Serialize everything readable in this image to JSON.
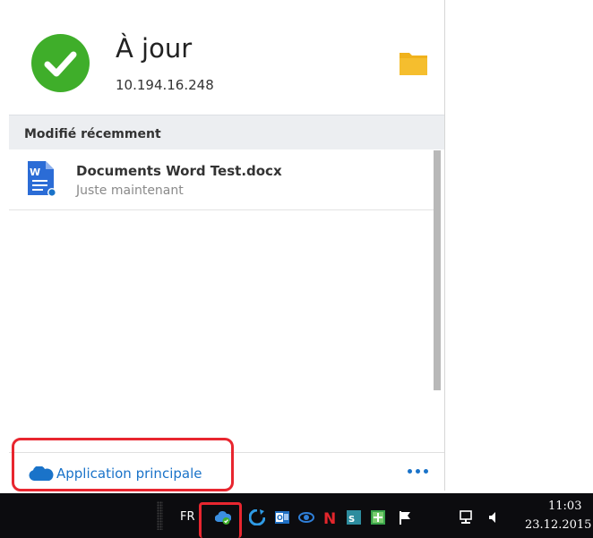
{
  "status": {
    "title": "À jour",
    "ip": "10.194.16.248",
    "icons": {
      "status": "checkmark-icon",
      "folder": "folder-icon"
    },
    "colors": {
      "ok_green": "#3fae2a",
      "folder": "#f0b21c"
    }
  },
  "recent": {
    "header": "Modifié récemment",
    "items": [
      {
        "name": "Documents Word Test.docx",
        "time": "Juste maintenant",
        "icon": "word-doc-icon"
      }
    ]
  },
  "footer": {
    "main_app_label": "Application principale",
    "icons": {
      "cloud": "cloud-icon",
      "more": "more-dots-icon"
    },
    "accent": "#1a73c9"
  },
  "taskbar": {
    "language": "FR",
    "tray_icons": [
      "synology-drive-icon",
      "sync-icon",
      "outlook-icon",
      "eye-icon",
      "onenote-icon",
      "app-icon",
      "shield-icon",
      "flag-icon",
      "network-icon",
      "volume-icon"
    ],
    "time": "11:03",
    "date": "23.12.2015"
  },
  "highlight_color": "#e8262f"
}
